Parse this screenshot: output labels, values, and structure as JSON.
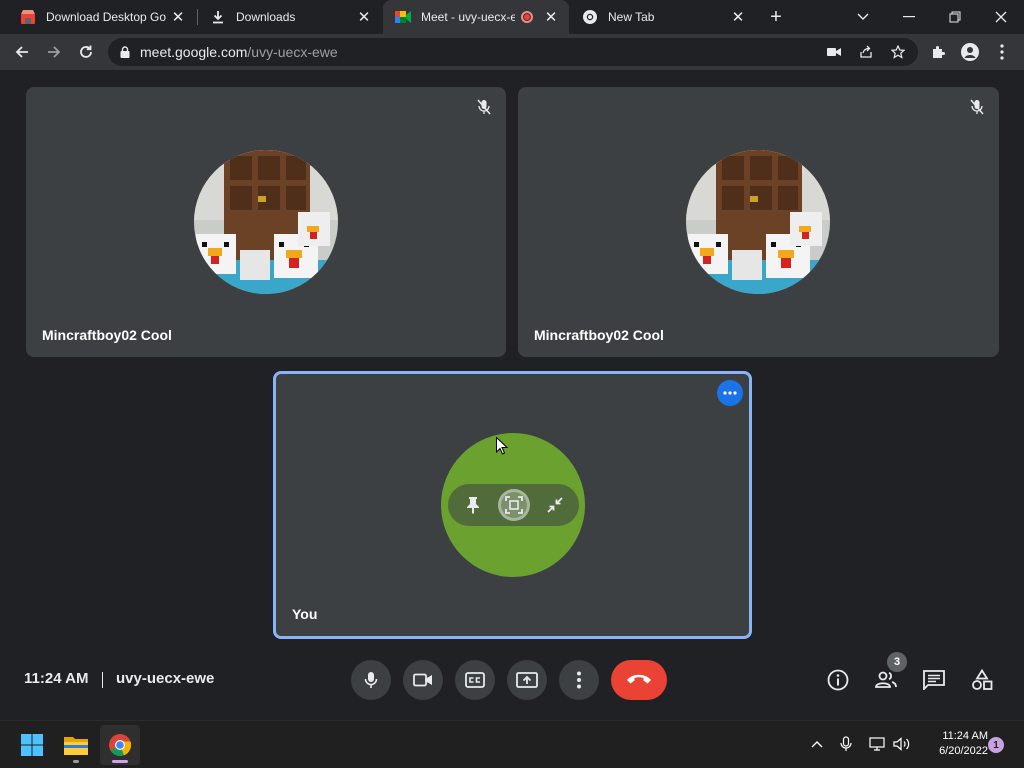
{
  "browser": {
    "tabs": [
      {
        "title": "Download Desktop Go",
        "favicon": "store-icon"
      },
      {
        "title": "Downloads",
        "favicon": "download-icon"
      },
      {
        "title": "Meet - uvy-uecx-ewe",
        "favicon": "meet-icon",
        "recording": true,
        "active": true
      },
      {
        "title": "New Tab",
        "favicon": "chrome-icon"
      }
    ],
    "url_host": "meet.google.com",
    "url_path": "/uvy-uecx-ewe"
  },
  "meet": {
    "participants": [
      {
        "name": "Mincraftboy02 Cool",
        "muted": true
      },
      {
        "name": "Mincraftboy02 Cool",
        "muted": true
      }
    ],
    "self": {
      "name": "You",
      "avatar_color": "#6aa12f"
    },
    "time": "11:24 AM",
    "meeting_code": "uvy-uecx-ewe",
    "people_count": "3",
    "colors": {
      "accent": "#8ab4f8",
      "end_call": "#ea4335",
      "tile": "#3c4043",
      "background": "#202124"
    }
  },
  "taskbar": {
    "time": "11:24 AM",
    "date": "6/20/2022",
    "notifications": "1"
  }
}
